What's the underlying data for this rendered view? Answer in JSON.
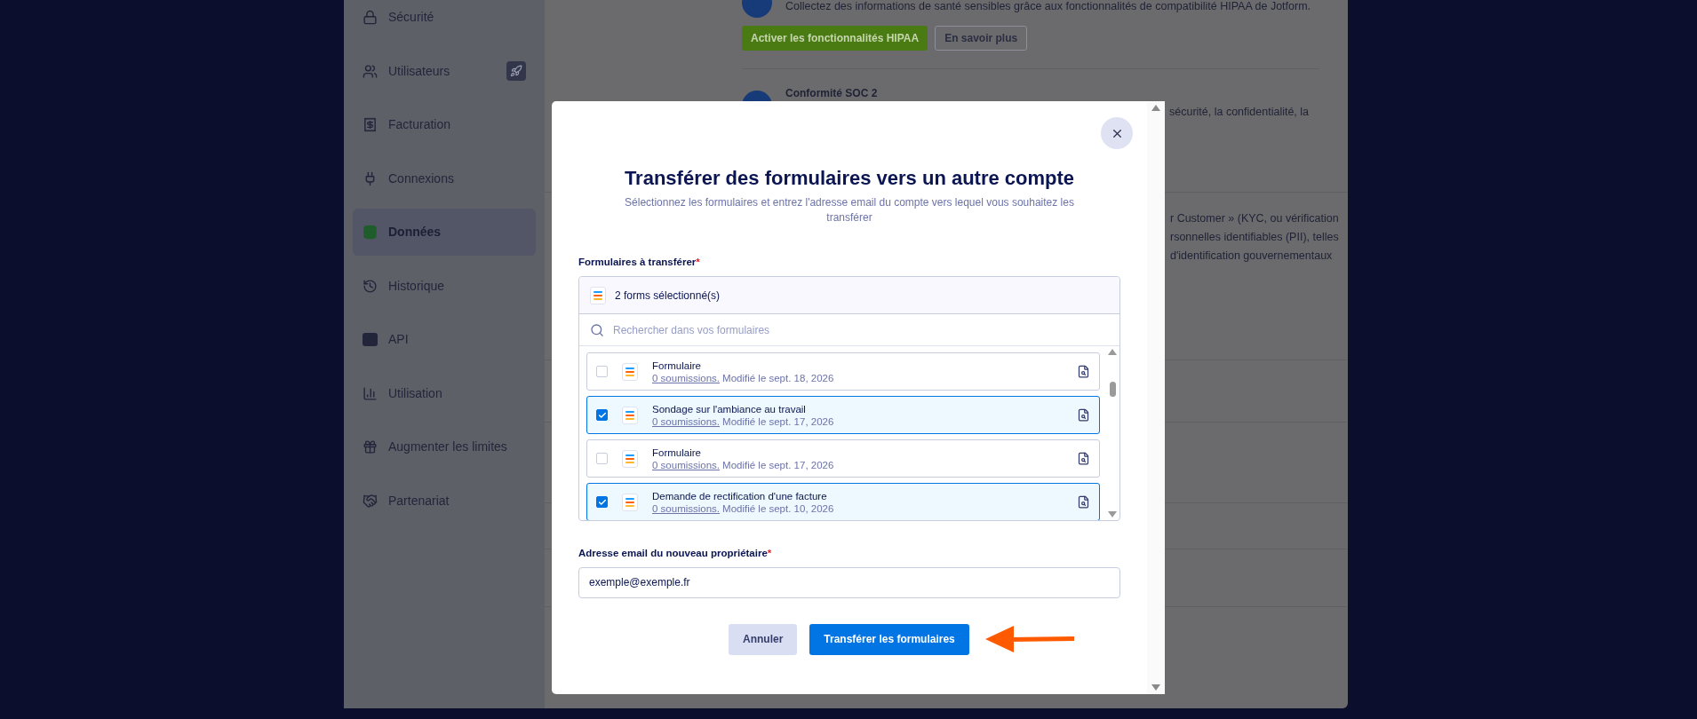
{
  "sidebar": {
    "items": [
      {
        "label": "Sécurité",
        "selected": false,
        "badge": false
      },
      {
        "label": "Utilisateurs",
        "selected": false,
        "badge": true
      },
      {
        "label": "Facturation",
        "selected": false,
        "badge": false
      },
      {
        "label": "Connexions",
        "selected": false,
        "badge": false
      },
      {
        "label": "Données",
        "selected": true,
        "badge": false
      },
      {
        "label": "Historique",
        "selected": false,
        "badge": false
      },
      {
        "label": "API",
        "selected": false,
        "badge": false
      },
      {
        "label": "Utilisation",
        "selected": false,
        "badge": false
      },
      {
        "label": "Augmenter les limites",
        "selected": false,
        "badge": false
      },
      {
        "label": "Partenariat",
        "selected": false,
        "badge": false
      }
    ]
  },
  "background": {
    "hipaa": {
      "description": "Collectez des informations de santé sensibles grâce aux fonctionnalités de compatibilité HIPAA de Jotform.",
      "primary_button": "Activer les fonctionnalités HIPAA",
      "secondary_button": "En savoir plus"
    },
    "soc2": {
      "title": "Conformité SOC 2",
      "description": "sécurité, la confidentialité, la"
    },
    "kyc": {
      "lines": [
        "r Customer » (KYC, ou vérification",
        "rsonnelles identifiables (PII), telles",
        "d'identification gouvernementaux"
      ]
    }
  },
  "modal": {
    "title": "Transférer des formulaires vers un autre compte",
    "subtitle": "Sélectionnez les formulaires et entrez l'adresse email du compte vers lequel vous souhaitez les transférer",
    "forms_label": {
      "text": "Formulaires à transférer",
      "required_mark": "*"
    },
    "selection_summary": "2 forms sélectionné(s)",
    "search": {
      "placeholder": "Rechercher dans vos formulaires"
    },
    "forms": [
      {
        "name": "Formulaire",
        "submissions": "0 soumissions.",
        "modified": "Modifié le sept. 18, 2026",
        "checked": false
      },
      {
        "name": "Sondage sur l'ambiance au travail",
        "submissions": "0 soumissions.",
        "modified": "Modifié le sept. 17, 2026",
        "checked": true
      },
      {
        "name": "Formulaire",
        "submissions": "0 soumissions.",
        "modified": "Modifié le sept. 17, 2026",
        "checked": false
      },
      {
        "name": "Demande de rectification d'une facture",
        "submissions": "0 soumissions.",
        "modified": "Modifié le sept. 10, 2026",
        "checked": true
      }
    ],
    "email": {
      "label": "Adresse email du nouveau propriétaire",
      "required_mark": "*",
      "value": "exemple@exemple.fr"
    },
    "buttons": {
      "cancel": "Annuler",
      "submit": "Transférer les formulaires"
    }
  }
}
